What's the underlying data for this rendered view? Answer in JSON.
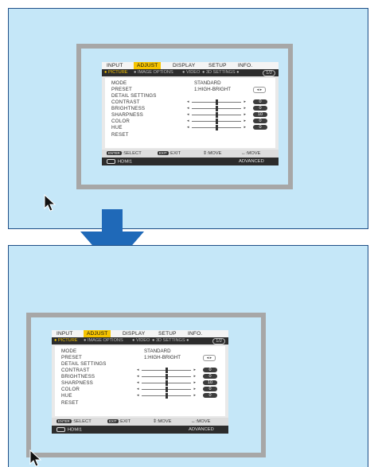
{
  "menu": {
    "tabs": [
      "INPUT",
      "ADJUST",
      "DISPLAY",
      "SETUP",
      "INFO."
    ],
    "active_tab": "ADJUST",
    "subtabs": [
      "PICTURE",
      "IMAGE OPTIONS",
      "VIDEO",
      "3D SETTINGS"
    ],
    "active_subtab": "PICTURE",
    "page": "1/2",
    "rows": {
      "mode": "MODE",
      "mode_value": "STANDARD",
      "preset": "PRESET",
      "preset_value": "1:HIGH-BRIGHT",
      "detail": "DETAIL SETTINGS",
      "contrast": "CONTRAST",
      "contrast_value": "0",
      "brightness": "BRIGHTNESS",
      "brightness_value": "0",
      "sharpness": "SHARPNESS",
      "sharpness_value": "10",
      "color": "COLOR",
      "color_value": "0",
      "hue": "HUE",
      "hue_value": "0",
      "reset": "RESET"
    },
    "slider_levels": [
      0.5,
      0.5,
      0.5,
      0.5,
      0.5
    ],
    "footer": {
      "enter_key": "ENTER",
      "select": ":SELECT",
      "exit_key": "EXIT",
      "exit": ":EXIT",
      "move_v": "⇕:MOVE",
      "move_h": "↔:MOVE",
      "source": "HDMI1",
      "mode": "ADVANCED"
    }
  },
  "colors": {
    "screen": "#c5e7f8",
    "frame": "#a7a7a7",
    "arrow": "#1f69b8",
    "highlight": "#f6c400"
  },
  "icons": [
    "mouse-pointer-icon",
    "down-arrow-icon",
    "hdmi-icon"
  ]
}
